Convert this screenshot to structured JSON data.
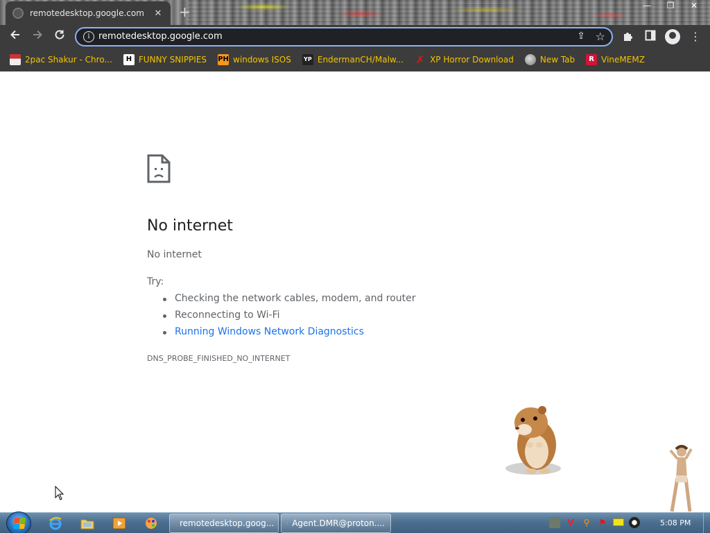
{
  "browser": {
    "tab": {
      "title": "remotedesktop.google.com"
    },
    "address_bar": {
      "url": "remotedesktop.google.com"
    },
    "bookmarks": [
      {
        "label": "2pac Shakur - Chro...",
        "icon": "2pac-favicon"
      },
      {
        "label": "FUNNY SNIPPIES",
        "icon": "H-favicon"
      },
      {
        "label": "windows ISOS",
        "icon": "PH-favicon"
      },
      {
        "label": "EndermanCH/Malw...",
        "icon": "YP-favicon"
      },
      {
        "label": "XP Horror Download",
        "icon": "X-favicon"
      },
      {
        "label": "New Tab",
        "icon": "globe-favicon"
      },
      {
        "label": "VineMEMZ",
        "icon": "R-favicon"
      }
    ]
  },
  "error_page": {
    "title": "No internet",
    "subtitle": "No internet",
    "try_label": "Try:",
    "suggestions": [
      "Checking the network cables, modem, and router",
      "Reconnecting to Wi-Fi",
      "Running Windows Network Diagnostics"
    ],
    "error_code": "DNS_PROBE_FINISHED_NO_INTERNET"
  },
  "taskbar": {
    "tasks": [
      {
        "label": "remotedesktop.goog...",
        "icon": "chrome-icon"
      },
      {
        "label": "Agent.DMR@proton....",
        "icon": "window-icon"
      }
    ],
    "clock": "5:08 PM"
  },
  "colors": {
    "accent_focus": "#8ab4f8",
    "link": "#1a73e8",
    "bookmark_text": "#f5c400",
    "chrome_dark": "#3c3c3c"
  }
}
